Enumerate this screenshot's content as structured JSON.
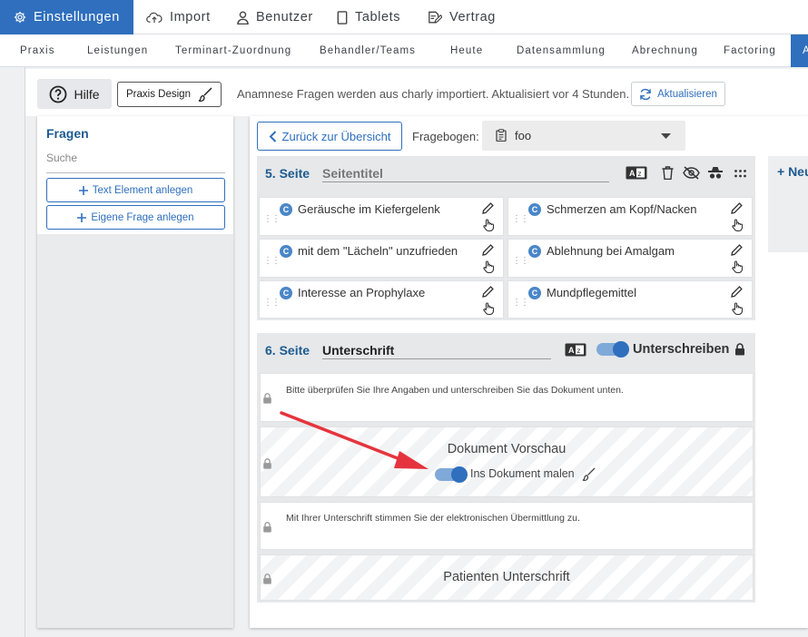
{
  "nav": {
    "tabs": [
      {
        "label": "Einstellungen",
        "icon": "gear-icon"
      },
      {
        "label": "Import",
        "icon": "cloud-upload-icon"
      },
      {
        "label": "Benutzer",
        "icon": "user-icon"
      },
      {
        "label": "Tablets",
        "icon": "tablet-icon"
      },
      {
        "label": "Vertrag",
        "icon": "contract-icon"
      }
    ],
    "subtabs": [
      "Praxis",
      "Leistungen",
      "Terminart-Zuordnung",
      "Behandler/Teams",
      "Heute",
      "Datensammlung",
      "Abrechnung",
      "Factoring",
      "A"
    ]
  },
  "toolbar": {
    "help_label": "Hilfe",
    "design_label": "Praxis Design",
    "info_text": "Anamnese Fragen werden aus charly importiert. Aktualisiert vor 4 Stunden.",
    "refresh_label": "Aktualisieren"
  },
  "left": {
    "title": "Fragen",
    "search_placeholder": "Suche",
    "btn_text_element": "Text Element anlegen",
    "btn_custom_question": "Eigene Frage anlegen"
  },
  "main": {
    "back_label": "Zurück zur Übersicht",
    "questionnaire_label": "Fragebogen:",
    "questionnaire_value": "foo",
    "new_label": "+ Neu"
  },
  "page5": {
    "number": "5. Seite",
    "title": "Seitentitel",
    "questions": [
      "Geräusche im Kiefergelenk",
      "Schmerzen am Kopf/Nacken",
      "mit dem \"Lächeln\" unzufrieden",
      "Ablehnung bei Amalgam",
      "Interesse an Prophylaxe",
      "Mundpflegemittel"
    ],
    "badge": "C"
  },
  "page6": {
    "number": "6. Seite",
    "title": "Unterschrift",
    "sign_label": "Unterschreiben",
    "text1": "Bitte überprüfen Sie Ihre Angaben und unterschreiben Sie das Dokument unten.",
    "preview_title": "Dokument Vorschau",
    "paint_label": "Ins Dokument malen",
    "text2": "Mit Ihrer Unterschrift stimmen Sie der elektronischen Übermittlung zu.",
    "patient_sig": "Patienten Unterschrift"
  },
  "colors": {
    "accent": "#2f6fbd",
    "title_blue": "#1d5b8f",
    "arrow": "#e5343d"
  }
}
